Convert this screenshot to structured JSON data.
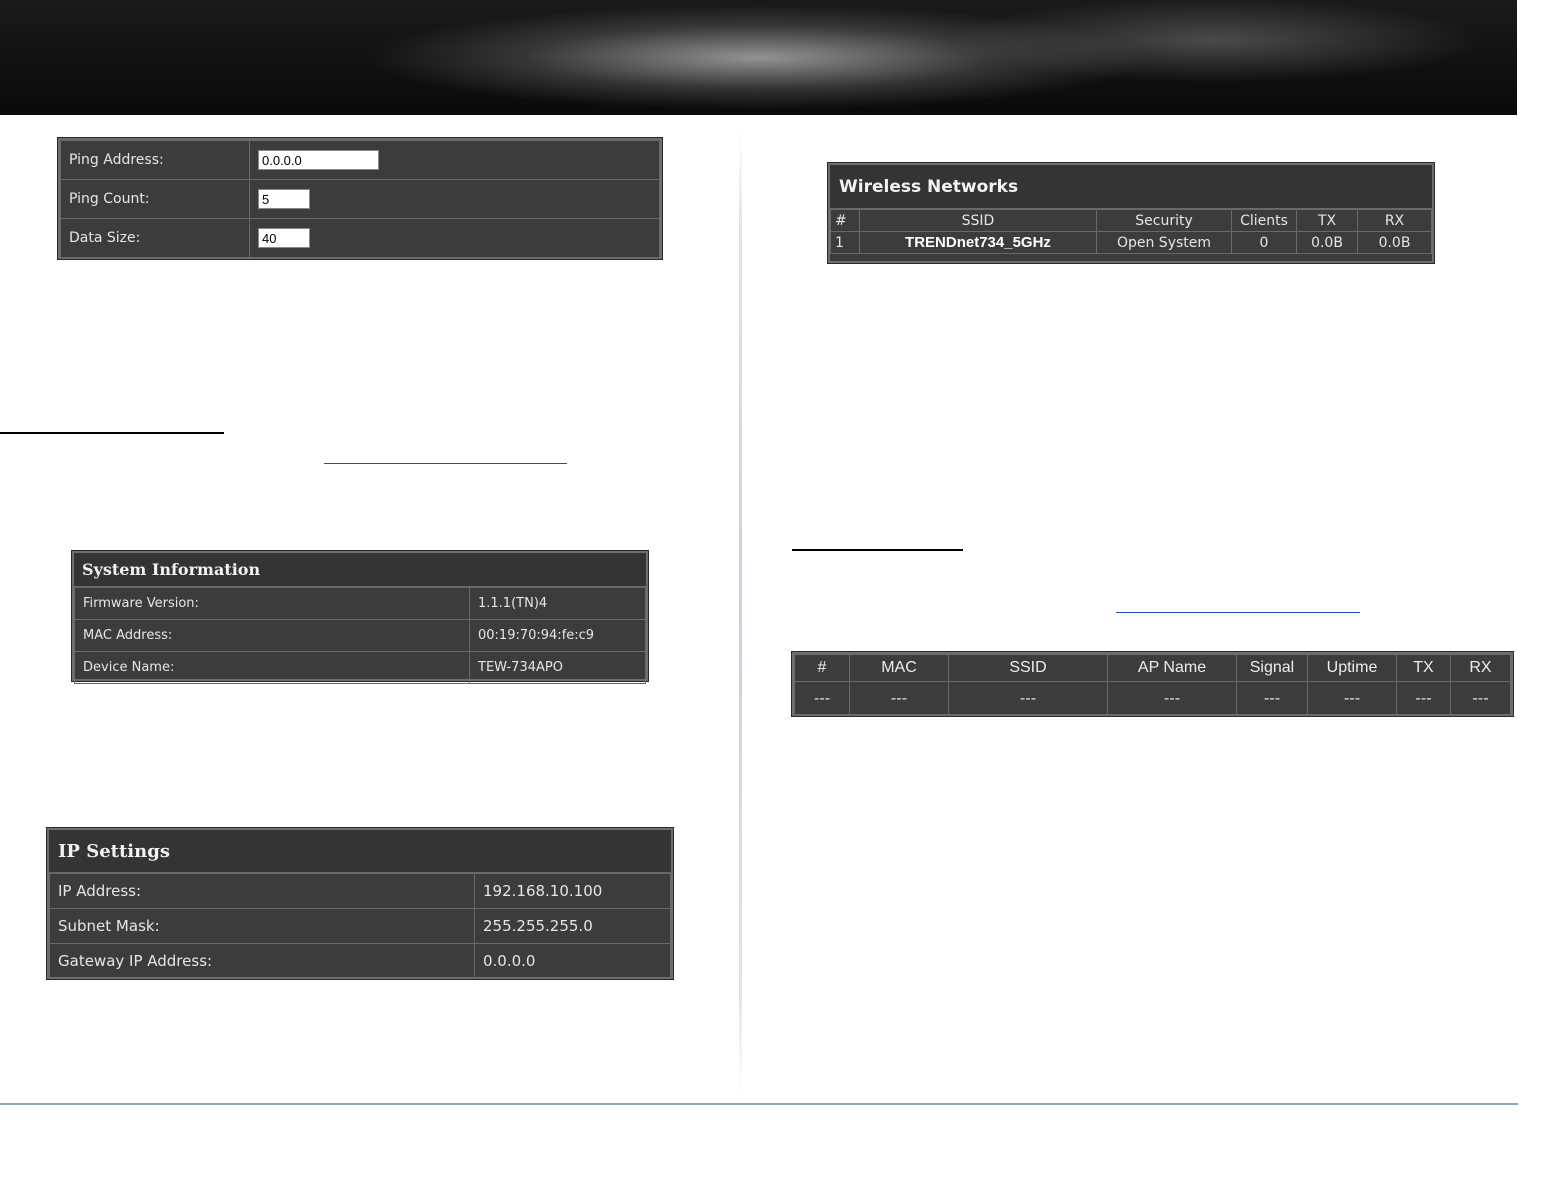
{
  "ping": {
    "rows": [
      {
        "label": "Ping Address:",
        "value": "0.0.0.0"
      },
      {
        "label": "Ping Count:",
        "value": "5"
      },
      {
        "label": "Data Size:",
        "value": "40"
      }
    ]
  },
  "system_info": {
    "title": "System Information",
    "rows": [
      {
        "label": "Firmware Version:",
        "value": "1.1.1(TN)4"
      },
      {
        "label": "MAC Address:",
        "value": "00:19:70:94:fe:c9"
      },
      {
        "label": "Device Name:",
        "value": "TEW-734APO"
      }
    ]
  },
  "ip_settings": {
    "title": "IP Settings",
    "rows": [
      {
        "label": "IP Address:",
        "value": "192.168.10.100"
      },
      {
        "label": "Subnet Mask:",
        "value": "255.255.255.0"
      },
      {
        "label": "Gateway IP Address:",
        "value": "0.0.0.0"
      }
    ]
  },
  "wireless_networks": {
    "title": "Wireless Networks",
    "columns": [
      "#",
      "SSID",
      "Security",
      "Clients",
      "TX",
      "RX"
    ],
    "rows": [
      [
        "1",
        "TRENDnet734_5GHz",
        "Open System",
        "0",
        "0.0B",
        "0.0B"
      ]
    ]
  },
  "clients": {
    "columns": [
      "#",
      "MAC",
      "SSID",
      "AP Name",
      "Signal",
      "Uptime",
      "TX",
      "RX"
    ],
    "rows": [
      [
        "---",
        "---",
        "---",
        "---",
        "---",
        "---",
        "---",
        "---"
      ]
    ]
  },
  "colors": {
    "panel_bg": "#3c3c3c",
    "panel_border": "#6e6e6e",
    "link": "#1f4fb3",
    "footer_rule": "#8fa6be"
  }
}
